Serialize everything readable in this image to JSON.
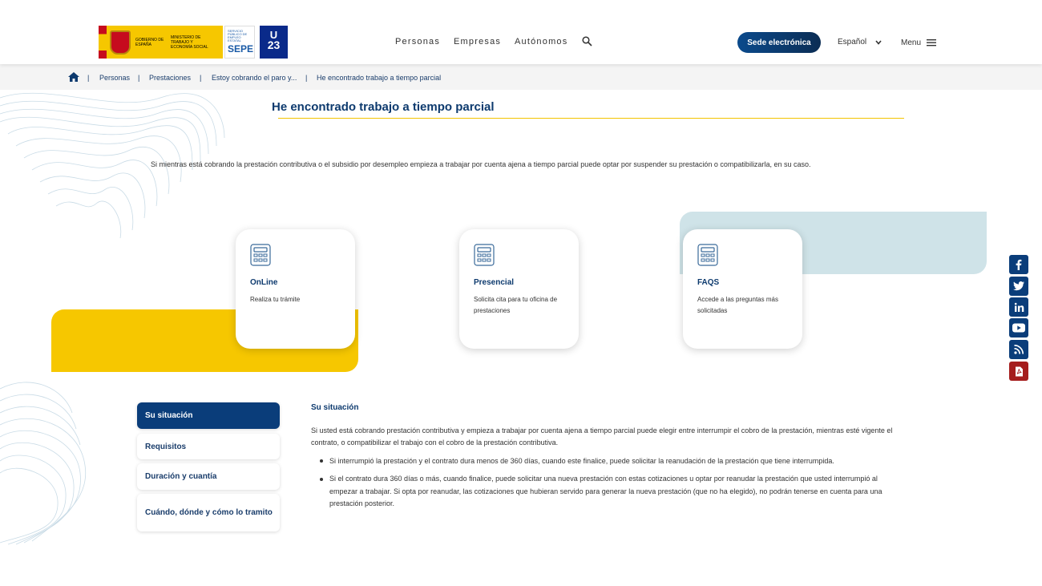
{
  "header": {
    "gob_text": "GOBIERNO DE ESPAÑA",
    "ministry_text": "MINISTERIO DE TRABAJO Y ECONOMÍA SOCIAL",
    "sepe_small": "SERVICIO PÚBLICO DE EMPLEO ESTATAL",
    "sepe_big": "SEPE",
    "ue_line1": "U",
    "ue_line2": "23",
    "nav": [
      "Personas",
      "Empresas",
      "Autónomos"
    ],
    "sede_button": "Sede electrónica",
    "language": "Español",
    "menu_label": "Menu"
  },
  "breadcrumb": {
    "items": [
      "Personas",
      "Prestaciones",
      "Estoy cobrando el paro y...",
      "He encontrado trabajo a tiempo parcial"
    ],
    "separator": "|"
  },
  "page": {
    "title": "He encontrado trabajo a tiempo parcial",
    "intro": "Si mientras está cobrando la prestación contributiva o el subsidio por desempleo empieza a trabajar por cuenta ajena a tiempo parcial puede optar por suspender su prestación o compatibilizarla, en su caso."
  },
  "cards": [
    {
      "title": "OnLine",
      "desc": "Realiza tu trámite"
    },
    {
      "title": "Presencial",
      "desc": "Solicita cita para tu oficina de prestaciones"
    },
    {
      "title": "FAQS",
      "desc": "Accede a las preguntas más solicitadas"
    }
  ],
  "sidebar": {
    "items": [
      "Su situación",
      "Requisitos",
      "Duración y cuantía",
      "Cuándo, dónde y cómo lo tramito"
    ]
  },
  "content": {
    "title": "Su situación",
    "paragraph": "Si usted está cobrando prestación contributiva y empieza a trabajar por cuenta ajena a tiempo parcial puede elegir entre interrumpir el cobro de la prestación, mientras esté vigente el contrato, o compatibilizar el trabajo con el cobro de la prestación contributiva.",
    "bullets": [
      "Si interrumpió la prestación y el contrato dura menos de 360 días, cuando este finalice, puede solicitar la reanudación de la prestación que tiene interrumpida.",
      "Si el contrato dura 360 días o más, cuando finalice, puede solicitar una nueva prestación con estas cotizaciones u optar por reanudar la prestación que usted interrumpió al empezar a trabajar. Si opta por reanudar, las cotizaciones que hubieran servido para generar la nueva prestación (que no ha elegido), no podrán tenerse en cuenta para una prestación posterior."
    ]
  },
  "social": [
    "facebook-icon",
    "twitter-icon",
    "linkedin-icon",
    "youtube-icon",
    "rss-icon",
    "pdf-icon"
  ],
  "colors": {
    "primary": "#0a3d7a",
    "accent_yellow": "#f6c700",
    "accent_blue": "#cfe3e8",
    "pdf_red": "#a51c1c"
  }
}
